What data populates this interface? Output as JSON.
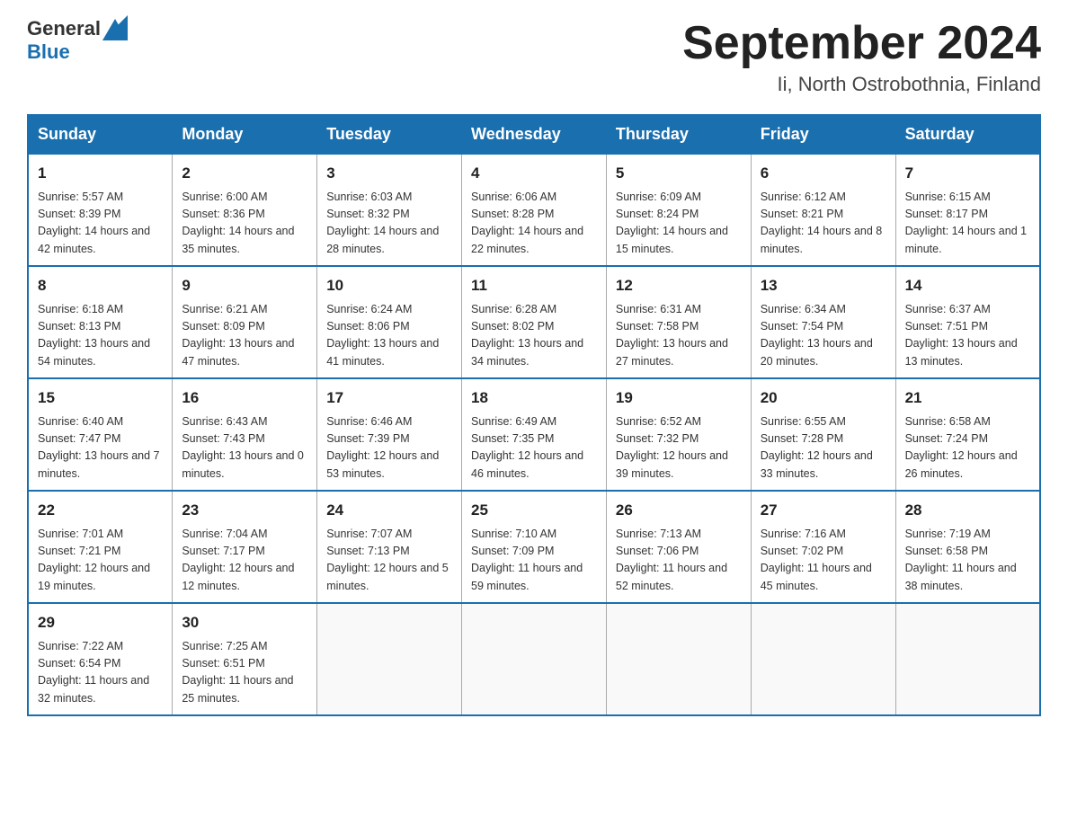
{
  "header": {
    "logo_general": "General",
    "logo_blue": "Blue",
    "month_title": "September 2024",
    "location": "Ii, North Ostrobothnia, Finland"
  },
  "days_of_week": [
    "Sunday",
    "Monday",
    "Tuesday",
    "Wednesday",
    "Thursday",
    "Friday",
    "Saturday"
  ],
  "weeks": [
    [
      {
        "day": "1",
        "sunrise": "Sunrise: 5:57 AM",
        "sunset": "Sunset: 8:39 PM",
        "daylight": "Daylight: 14 hours and 42 minutes."
      },
      {
        "day": "2",
        "sunrise": "Sunrise: 6:00 AM",
        "sunset": "Sunset: 8:36 PM",
        "daylight": "Daylight: 14 hours and 35 minutes."
      },
      {
        "day": "3",
        "sunrise": "Sunrise: 6:03 AM",
        "sunset": "Sunset: 8:32 PM",
        "daylight": "Daylight: 14 hours and 28 minutes."
      },
      {
        "day": "4",
        "sunrise": "Sunrise: 6:06 AM",
        "sunset": "Sunset: 8:28 PM",
        "daylight": "Daylight: 14 hours and 22 minutes."
      },
      {
        "day": "5",
        "sunrise": "Sunrise: 6:09 AM",
        "sunset": "Sunset: 8:24 PM",
        "daylight": "Daylight: 14 hours and 15 minutes."
      },
      {
        "day": "6",
        "sunrise": "Sunrise: 6:12 AM",
        "sunset": "Sunset: 8:21 PM",
        "daylight": "Daylight: 14 hours and 8 minutes."
      },
      {
        "day": "7",
        "sunrise": "Sunrise: 6:15 AM",
        "sunset": "Sunset: 8:17 PM",
        "daylight": "Daylight: 14 hours and 1 minute."
      }
    ],
    [
      {
        "day": "8",
        "sunrise": "Sunrise: 6:18 AM",
        "sunset": "Sunset: 8:13 PM",
        "daylight": "Daylight: 13 hours and 54 minutes."
      },
      {
        "day": "9",
        "sunrise": "Sunrise: 6:21 AM",
        "sunset": "Sunset: 8:09 PM",
        "daylight": "Daylight: 13 hours and 47 minutes."
      },
      {
        "day": "10",
        "sunrise": "Sunrise: 6:24 AM",
        "sunset": "Sunset: 8:06 PM",
        "daylight": "Daylight: 13 hours and 41 minutes."
      },
      {
        "day": "11",
        "sunrise": "Sunrise: 6:28 AM",
        "sunset": "Sunset: 8:02 PM",
        "daylight": "Daylight: 13 hours and 34 minutes."
      },
      {
        "day": "12",
        "sunrise": "Sunrise: 6:31 AM",
        "sunset": "Sunset: 7:58 PM",
        "daylight": "Daylight: 13 hours and 27 minutes."
      },
      {
        "day": "13",
        "sunrise": "Sunrise: 6:34 AM",
        "sunset": "Sunset: 7:54 PM",
        "daylight": "Daylight: 13 hours and 20 minutes."
      },
      {
        "day": "14",
        "sunrise": "Sunrise: 6:37 AM",
        "sunset": "Sunset: 7:51 PM",
        "daylight": "Daylight: 13 hours and 13 minutes."
      }
    ],
    [
      {
        "day": "15",
        "sunrise": "Sunrise: 6:40 AM",
        "sunset": "Sunset: 7:47 PM",
        "daylight": "Daylight: 13 hours and 7 minutes."
      },
      {
        "day": "16",
        "sunrise": "Sunrise: 6:43 AM",
        "sunset": "Sunset: 7:43 PM",
        "daylight": "Daylight: 13 hours and 0 minutes."
      },
      {
        "day": "17",
        "sunrise": "Sunrise: 6:46 AM",
        "sunset": "Sunset: 7:39 PM",
        "daylight": "Daylight: 12 hours and 53 minutes."
      },
      {
        "day": "18",
        "sunrise": "Sunrise: 6:49 AM",
        "sunset": "Sunset: 7:35 PM",
        "daylight": "Daylight: 12 hours and 46 minutes."
      },
      {
        "day": "19",
        "sunrise": "Sunrise: 6:52 AM",
        "sunset": "Sunset: 7:32 PM",
        "daylight": "Daylight: 12 hours and 39 minutes."
      },
      {
        "day": "20",
        "sunrise": "Sunrise: 6:55 AM",
        "sunset": "Sunset: 7:28 PM",
        "daylight": "Daylight: 12 hours and 33 minutes."
      },
      {
        "day": "21",
        "sunrise": "Sunrise: 6:58 AM",
        "sunset": "Sunset: 7:24 PM",
        "daylight": "Daylight: 12 hours and 26 minutes."
      }
    ],
    [
      {
        "day": "22",
        "sunrise": "Sunrise: 7:01 AM",
        "sunset": "Sunset: 7:21 PM",
        "daylight": "Daylight: 12 hours and 19 minutes."
      },
      {
        "day": "23",
        "sunrise": "Sunrise: 7:04 AM",
        "sunset": "Sunset: 7:17 PM",
        "daylight": "Daylight: 12 hours and 12 minutes."
      },
      {
        "day": "24",
        "sunrise": "Sunrise: 7:07 AM",
        "sunset": "Sunset: 7:13 PM",
        "daylight": "Daylight: 12 hours and 5 minutes."
      },
      {
        "day": "25",
        "sunrise": "Sunrise: 7:10 AM",
        "sunset": "Sunset: 7:09 PM",
        "daylight": "Daylight: 11 hours and 59 minutes."
      },
      {
        "day": "26",
        "sunrise": "Sunrise: 7:13 AM",
        "sunset": "Sunset: 7:06 PM",
        "daylight": "Daylight: 11 hours and 52 minutes."
      },
      {
        "day": "27",
        "sunrise": "Sunrise: 7:16 AM",
        "sunset": "Sunset: 7:02 PM",
        "daylight": "Daylight: 11 hours and 45 minutes."
      },
      {
        "day": "28",
        "sunrise": "Sunrise: 7:19 AM",
        "sunset": "Sunset: 6:58 PM",
        "daylight": "Daylight: 11 hours and 38 minutes."
      }
    ],
    [
      {
        "day": "29",
        "sunrise": "Sunrise: 7:22 AM",
        "sunset": "Sunset: 6:54 PM",
        "daylight": "Daylight: 11 hours and 32 minutes."
      },
      {
        "day": "30",
        "sunrise": "Sunrise: 7:25 AM",
        "sunset": "Sunset: 6:51 PM",
        "daylight": "Daylight: 11 hours and 25 minutes."
      },
      null,
      null,
      null,
      null,
      null
    ]
  ]
}
